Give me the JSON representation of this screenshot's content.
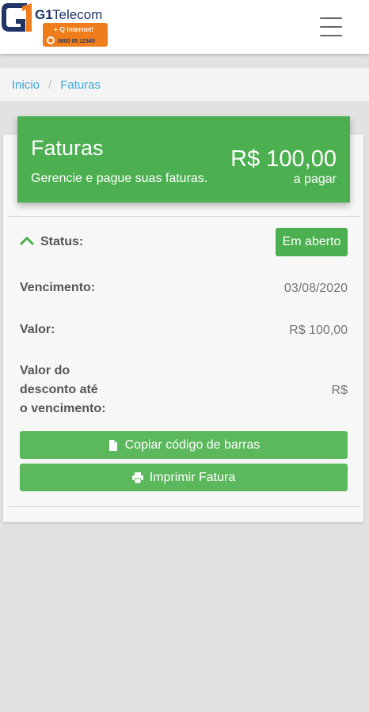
{
  "brand": {
    "name": "G1Telecom",
    "tagline": "+ Q Internet!",
    "phone": "0800 05 12345"
  },
  "breadcrumb": {
    "home": "Inicio",
    "separator": "/",
    "current": "Faturas"
  },
  "hero": {
    "title": "Faturas",
    "subtitle": "Gerencie e pague suas faturas.",
    "amount": "R$ 100,00",
    "amount_caption": "a pagar"
  },
  "invoice": {
    "status_label": "Status:",
    "status_value": "Em aberto",
    "due_label": "Vencimento:",
    "due_value": "03/08/2020",
    "value_label": "Valor:",
    "value_value": "R$ 100,00",
    "discount_label_lines": [
      "Valor do",
      "desconto até",
      "o vencimento:"
    ],
    "discount_value": "R$"
  },
  "actions": {
    "copy_barcode": "Copiar código de barras",
    "print": "Imprimir Fatura"
  },
  "colors": {
    "green": "#4caf50",
    "button_green": "#5cb85c",
    "link_blue": "#3aa7d8",
    "logo_navy": "#1f3566",
    "logo_orange": "#f07d1c"
  },
  "icons": {
    "menu": "hamburger-icon",
    "collapse": "chevron-up-icon",
    "copy": "file-icon",
    "print": "printer-icon"
  }
}
